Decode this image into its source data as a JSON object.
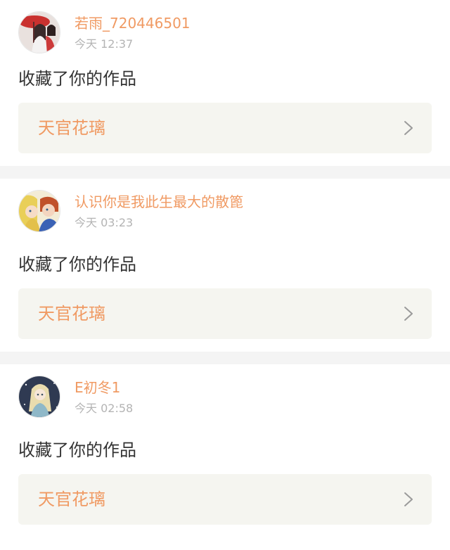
{
  "notifications": [
    {
      "user": "若雨_720446501",
      "time": "今天 12:37",
      "action": "收藏了你的作品",
      "work_title": "天官花璃",
      "avatar_icon": "avatar-girl-red-umbrella-icon"
    },
    {
      "user": "认识你是我此生最大的散篦",
      "time": "今天 03:23",
      "action": "收藏了你的作品",
      "work_title": "天官花璃",
      "avatar_icon": "avatar-anime-couple-icon"
    },
    {
      "user": "E初冬1",
      "time": "今天 02:58",
      "action": "收藏了你的作品",
      "work_title": "天官花璃",
      "avatar_icon": "avatar-anime-girl-night-icon"
    }
  ],
  "colors": {
    "accent": "#f09a63",
    "time_text": "#b4b4b4",
    "body_text": "#333333",
    "link_bg": "#f5f5f0",
    "divider_bg": "#f4f4f4"
  }
}
